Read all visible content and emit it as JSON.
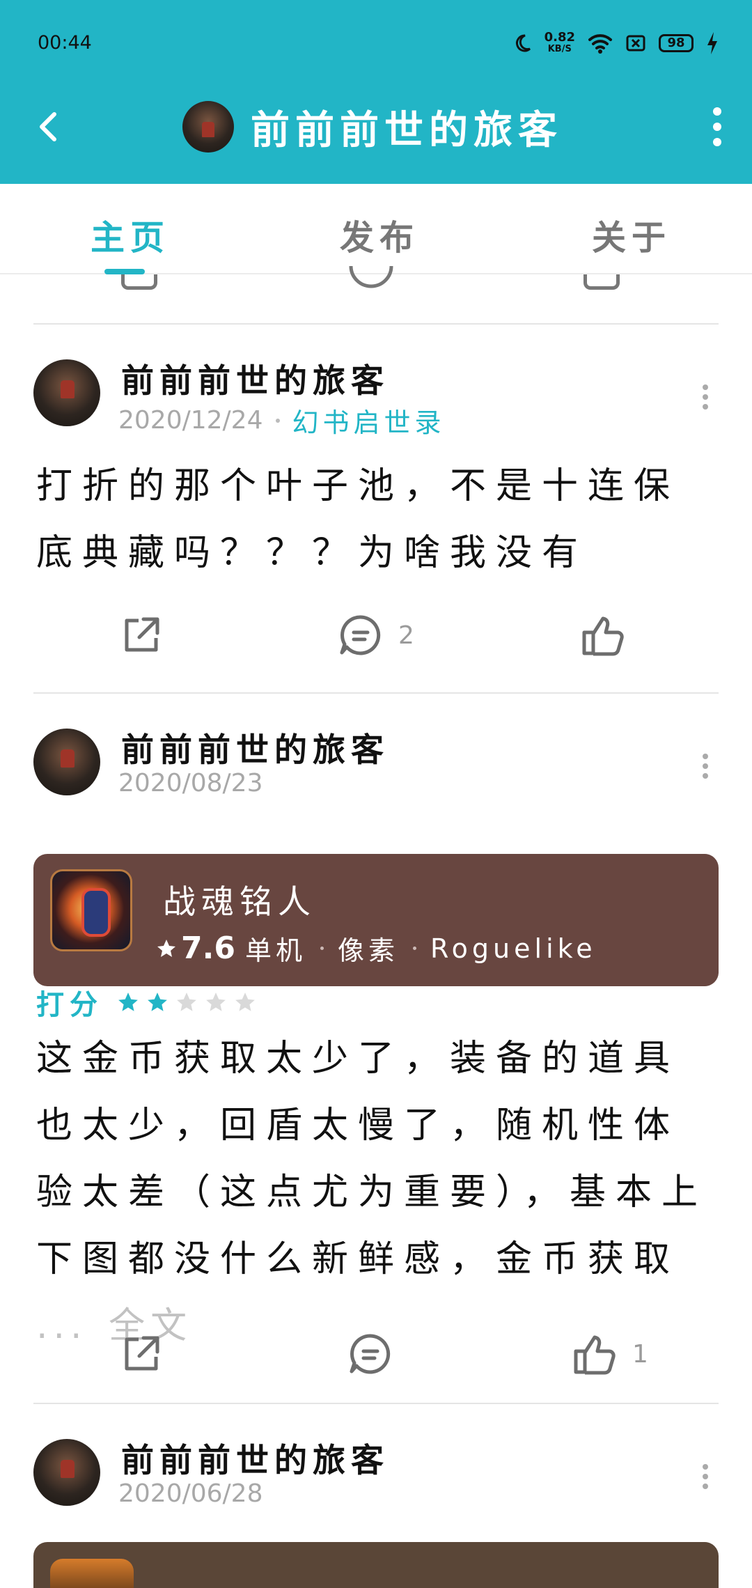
{
  "status_bar": {
    "time": "00:44",
    "network_speed_value": "0.82",
    "network_speed_unit": "KB/S",
    "battery": "98"
  },
  "header": {
    "title": "前前前世的旅客"
  },
  "tabs": [
    {
      "label": "主页",
      "active": true
    },
    {
      "label": "发布",
      "active": false
    },
    {
      "label": "关于",
      "active": false
    }
  ],
  "posts": [
    {
      "user": "前前前世的旅客",
      "date": "2020/12/24",
      "game_tag": "幻书启世录",
      "text": "打折的那个叶子池，不是十连保底典藏吗？？？为啥我没有",
      "comment_count": "2",
      "like_count": ""
    },
    {
      "user": "前前前世的旅客",
      "date": "2020/08/23",
      "game": {
        "name": "战魂铭人",
        "score": "7.6",
        "tags": [
          "单机",
          "像素",
          "Roguelike"
        ]
      },
      "rating_label": "打分",
      "rating": 2,
      "text": "这金币获取太少了，装备的道具也太少，回盾太慢了，随机性体验太差（这点尤为重要），基本上下图都没什么新鲜感，金币获取",
      "ellipsis": "...",
      "read_more": "全文",
      "comment_count": "",
      "like_count": "1"
    },
    {
      "user": "前前前世的旅客",
      "date": "2020/06/28"
    }
  ],
  "colors": {
    "accent": "#22b5c6",
    "card_brown": "#684640",
    "muted": "#a8a8a8"
  }
}
